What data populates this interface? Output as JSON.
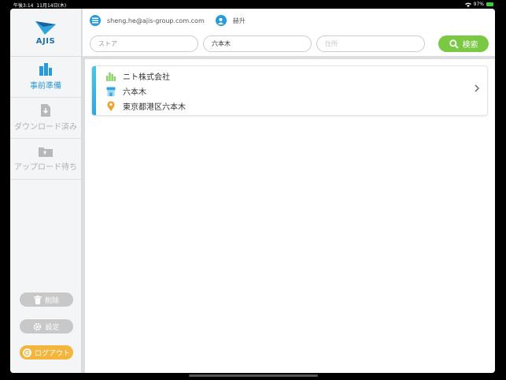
{
  "status_bar": {
    "time": "午後3:14",
    "date": "11月14日(木)",
    "battery_percent": "97%"
  },
  "sidebar": {
    "logo_text": "AJIS",
    "items": [
      {
        "label": "事前準備",
        "icon": "buildings-icon",
        "active": true
      },
      {
        "label": "ダウンロード済み",
        "icon": "download-doc-icon",
        "active": false
      },
      {
        "label": "アップロード待ち",
        "icon": "upload-folder-icon",
        "active": false
      }
    ],
    "delete_label": "削除",
    "settings_label": "設定",
    "logout_label": "ログアウト"
  },
  "header": {
    "email": "sheng.he@ajis-group.com.com",
    "username": "赫升",
    "store_placeholder": "ストア",
    "area_value": "六本木",
    "address_placeholder": "住所",
    "search_label": "検索"
  },
  "results": [
    {
      "company": "ニト株式会社",
      "store": "六本木",
      "address": "東京都港区六本木"
    }
  ],
  "colors": {
    "accent_blue": "#2a9ad8",
    "search_green": "#7ac943",
    "logout_orange": "#f4b53c",
    "card_accent": "#46c6ea"
  }
}
